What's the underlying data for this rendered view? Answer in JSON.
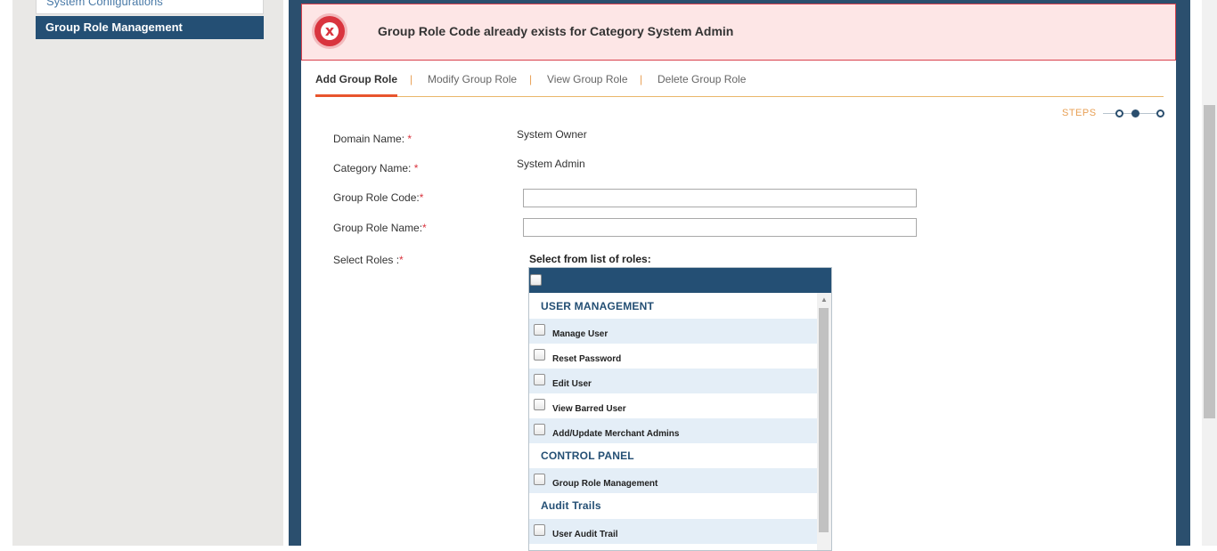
{
  "sidebar": {
    "items": [
      {
        "label": "System Configurations"
      },
      {
        "label": "Group Role Management"
      }
    ]
  },
  "alert": {
    "message": "Group Role Code already exists for Category System Admin",
    "icon": "error-x-icon",
    "color": "#d9343e"
  },
  "tabs": [
    {
      "label": "Add Group Role",
      "active": true
    },
    {
      "label": "Modify Group Role"
    },
    {
      "label": "View Group Role"
    },
    {
      "label": "Delete Group Role"
    }
  ],
  "tab_separator": "|",
  "steps": {
    "label": "STEPS",
    "current": 2,
    "total": 3
  },
  "form": {
    "domain_label": "Domain Name:",
    "domain_value": "System Owner",
    "category_label": "Category Name:",
    "category_value": "System Admin",
    "code_label": "Group Role Code:",
    "code_value": "",
    "name_label": "Group Role Name:",
    "name_value": "",
    "roles_label": "Select Roles :",
    "required_mark": "*"
  },
  "roles": {
    "title": "Select from list of roles:",
    "groups": [
      {
        "name": "USER MANAGEMENT",
        "items": [
          "Manage User",
          "Reset Password",
          "Edit User",
          "View Barred User",
          "Add/Update Merchant Admins"
        ]
      },
      {
        "name": "CONTROL PANEL",
        "items": [
          "Group Role Management"
        ]
      },
      {
        "name": "Audit Trails",
        "items": [
          "User Audit Trail"
        ]
      }
    ]
  },
  "colors": {
    "primary": "#244f74",
    "frame": "#2b4f6e",
    "accent": "#e8552d",
    "alert_bg": "#fde6e6"
  }
}
